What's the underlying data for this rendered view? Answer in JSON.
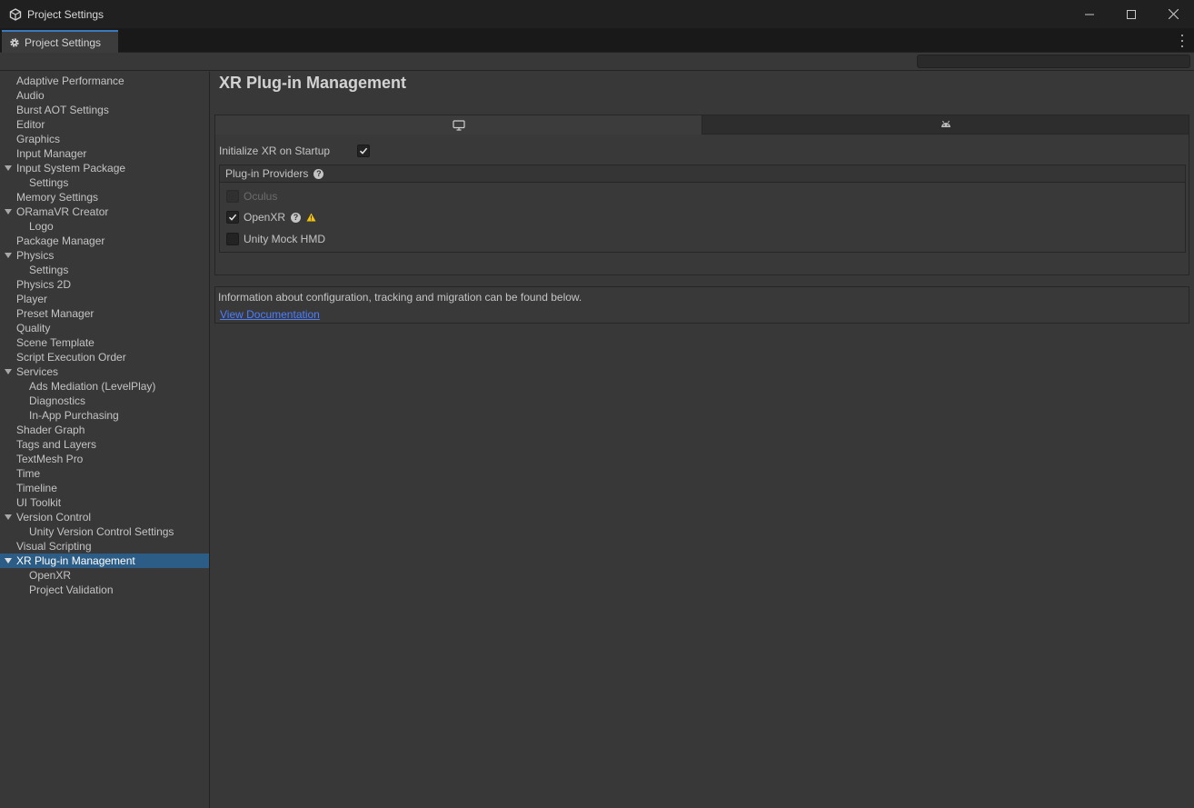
{
  "window": {
    "title": "Project Settings",
    "icon": "unity-cube-icon"
  },
  "tab": {
    "label": "Project Settings",
    "icon": "gear-icon"
  },
  "search": {
    "placeholder": "",
    "value": ""
  },
  "sidebar": {
    "items": [
      {
        "label": "Adaptive Performance",
        "level": 0
      },
      {
        "label": "Audio",
        "level": 0
      },
      {
        "label": "Burst AOT Settings",
        "level": 0
      },
      {
        "label": "Editor",
        "level": 0
      },
      {
        "label": "Graphics",
        "level": 0
      },
      {
        "label": "Input Manager",
        "level": 0
      },
      {
        "label": "Input System Package",
        "level": 0,
        "expanded": true
      },
      {
        "label": "Settings",
        "level": 1
      },
      {
        "label": "Memory Settings",
        "level": 0
      },
      {
        "label": "ORamaVR Creator",
        "level": 0,
        "expanded": true
      },
      {
        "label": "Logo",
        "level": 1
      },
      {
        "label": "Package Manager",
        "level": 0
      },
      {
        "label": "Physics",
        "level": 0,
        "expanded": true
      },
      {
        "label": "Settings",
        "level": 1
      },
      {
        "label": "Physics 2D",
        "level": 0
      },
      {
        "label": "Player",
        "level": 0
      },
      {
        "label": "Preset Manager",
        "level": 0
      },
      {
        "label": "Quality",
        "level": 0
      },
      {
        "label": "Scene Template",
        "level": 0
      },
      {
        "label": "Script Execution Order",
        "level": 0
      },
      {
        "label": "Services",
        "level": 0,
        "expanded": true
      },
      {
        "label": "Ads Mediation (LevelPlay)",
        "level": 1
      },
      {
        "label": "Diagnostics",
        "level": 1
      },
      {
        "label": "In-App Purchasing",
        "level": 1
      },
      {
        "label": "Shader Graph",
        "level": 0
      },
      {
        "label": "Tags and Layers",
        "level": 0
      },
      {
        "label": "TextMesh Pro",
        "level": 0
      },
      {
        "label": "Time",
        "level": 0
      },
      {
        "label": "Timeline",
        "level": 0
      },
      {
        "label": "UI Toolkit",
        "level": 0
      },
      {
        "label": "Version Control",
        "level": 0,
        "expanded": true
      },
      {
        "label": "Unity Version Control Settings",
        "level": 1
      },
      {
        "label": "Visual Scripting",
        "level": 0
      },
      {
        "label": "XR Plug-in Management",
        "level": 0,
        "expanded": true,
        "selected": true
      },
      {
        "label": "OpenXR",
        "level": 1
      },
      {
        "label": "Project Validation",
        "level": 1
      }
    ]
  },
  "main": {
    "title": "XR Plug-in Management",
    "platform_tabs": [
      {
        "icon": "desktop-monitor-icon",
        "active": true
      },
      {
        "icon": "android-icon",
        "active": false
      }
    ],
    "init_xr": {
      "label": "Initialize XR on Startup",
      "checked": true
    },
    "providers": {
      "header": "Plug-in Providers",
      "items": [
        {
          "label": "Oculus",
          "checked": false,
          "disabled": true
        },
        {
          "label": "OpenXR",
          "checked": true,
          "help": true,
          "warning": true
        },
        {
          "label": "Unity Mock HMD",
          "checked": false
        }
      ]
    },
    "info": {
      "text": "Information about configuration, tracking and migration can be found below.",
      "link": "View Documentation"
    }
  },
  "colors": {
    "selection": "#2c5d87",
    "link": "#4c7eff",
    "warning": "#f4c20d",
    "tab_accent": "#3a79bb"
  }
}
